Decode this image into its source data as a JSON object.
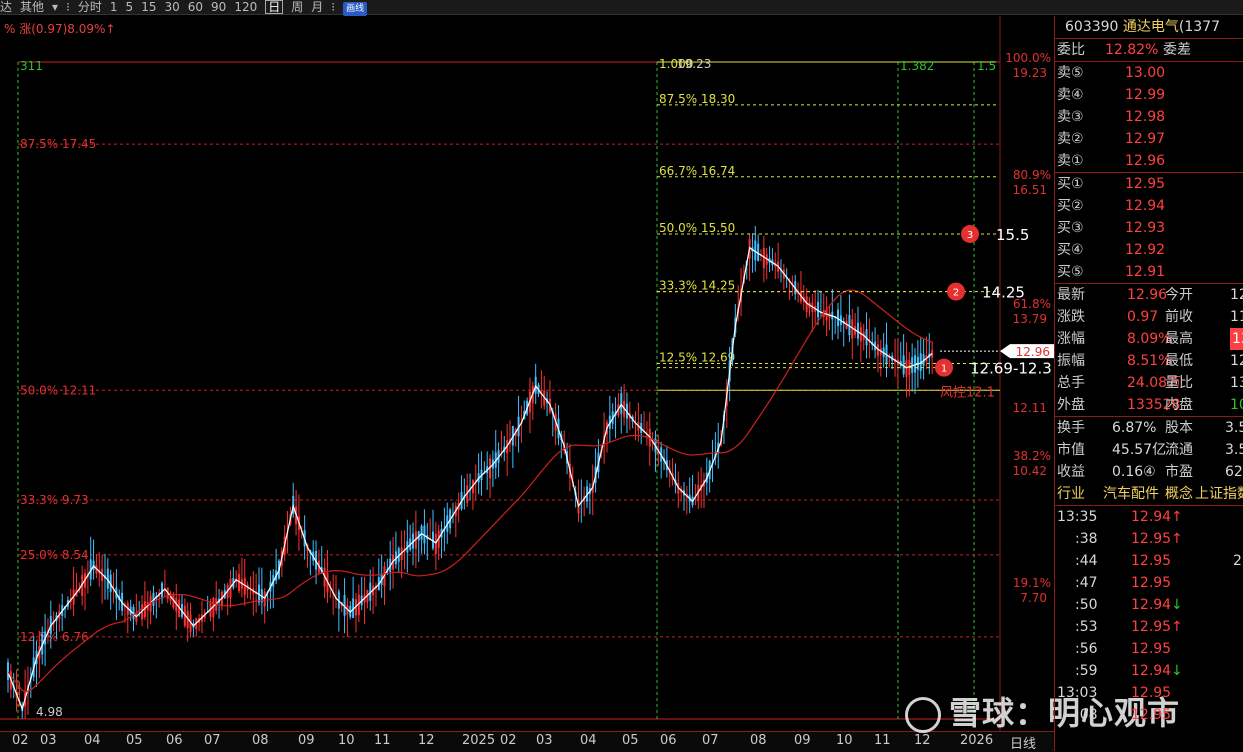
{
  "toolbar": {
    "items": [
      "达",
      "其他",
      "▾",
      "⁝",
      "分时",
      "1",
      "5",
      "15",
      "30",
      "60",
      "90",
      "120",
      "日",
      "周",
      "月",
      "⁝"
    ],
    "active": "日",
    "badge": "画线"
  },
  "indicator": "% 涨(0.97)8.09%↑",
  "stock": {
    "code": "603390",
    "name": "通达电气",
    "extra": "(1377"
  },
  "weibi": {
    "label1": "委比",
    "value": "12.82%",
    "label2": "委差"
  },
  "sell": [
    {
      "label": "卖⑤",
      "price": "13.00"
    },
    {
      "label": "卖④",
      "price": "12.99"
    },
    {
      "label": "卖③",
      "price": "12.98"
    },
    {
      "label": "卖②",
      "price": "12.97"
    },
    {
      "label": "卖①",
      "price": "12.96"
    }
  ],
  "buy": [
    {
      "label": "买①",
      "price": "12.95"
    },
    {
      "label": "买②",
      "price": "12.94"
    },
    {
      "label": "买③",
      "price": "12.93"
    },
    {
      "label": "买④",
      "price": "12.92"
    },
    {
      "label": "买⑤",
      "price": "12.91"
    }
  ],
  "quote": [
    {
      "l1": "最新",
      "v1": "12.96",
      "l2": "今开",
      "v2": "12"
    },
    {
      "l1": "涨跌",
      "v1": "0.97",
      "l2": "前收",
      "v2": "11"
    },
    {
      "l1": "涨幅",
      "v1": "8.09%",
      "l2": "最高",
      "v2": "13"
    },
    {
      "l1": "振幅",
      "v1": "8.51%",
      "l2": "最低",
      "v2": "12"
    },
    {
      "l1": "总手",
      "v1": "24.08万",
      "l2": "量比",
      "v2": "13"
    },
    {
      "l1": "外盘",
      "v1": "133528",
      "l2": "内盘",
      "v2": "107"
    }
  ],
  "stats": [
    {
      "l1": "换手",
      "v1": "6.87%",
      "l2": "股本",
      "v2": "3.5"
    },
    {
      "l1": "市值",
      "v1": "45.57亿",
      "l2": "流通",
      "v2": "3.5"
    },
    {
      "l1": "收益",
      "v1": "0.16④",
      "l2": "市盈",
      "v2": "62"
    }
  ],
  "industry": {
    "l1": "行业",
    "v1": "汽车配件",
    "l2": "概念",
    "v2": "上证指数"
  },
  "ticks": [
    {
      "t": "13:35",
      "p": "12.94",
      "a": "↑",
      "v": ""
    },
    {
      "t": ":38",
      "p": "12.95",
      "a": "↑",
      "v": ""
    },
    {
      "t": ":44",
      "p": "12.95",
      "a": "",
      "v": "2"
    },
    {
      "t": ":47",
      "p": "12.95",
      "a": "",
      "v": ""
    },
    {
      "t": ":50",
      "p": "12.94",
      "a": "↓",
      "v": ""
    },
    {
      "t": ":53",
      "p": "12.95",
      "a": "↑",
      "v": ""
    },
    {
      "t": ":56",
      "p": "12.95",
      "a": "",
      "v": ""
    },
    {
      "t": ":59",
      "p": "12.94",
      "a": "↓",
      "v": ""
    },
    {
      "t": "13:03",
      "p": "12.95",
      "a": "",
      "v": ""
    },
    {
      "t": ":08",
      "p": "12.95",
      "a": "",
      "v": ""
    }
  ],
  "watermark": "雪球：明心观市",
  "price_axis": [
    {
      "pct": "100.0%",
      "price": "19.23"
    },
    {
      "pct": "80.9%",
      "price": "16.51"
    },
    {
      "pct": "61.8%",
      "price": "13.79"
    },
    {
      "pct": "",
      "price": "12.11"
    },
    {
      "pct": "38.2%",
      "price": "10.42"
    },
    {
      "pct": "19.1%",
      "price": "7.70"
    },
    {
      "pct": "",
      "price": "4.98"
    }
  ],
  "current_price_tag": "12.96",
  "left_fib": [
    {
      "label": "87.5% 17.45",
      "price": 17.45
    },
    {
      "label": "50.0% 12.11",
      "price": 12.11
    },
    {
      "label": "33.3% 9.73",
      "price": 9.73
    },
    {
      "label": "25.0% 8.54",
      "price": 8.54
    },
    {
      "label": "12.5% 6.76",
      "price": 6.76
    }
  ],
  "right_fib": [
    {
      "label": "1.000",
      "price": 19.23
    },
    {
      "label": "87.5% 18.30",
      "price": 18.3
    },
    {
      "label": "66.7% 16.74",
      "price": 16.74
    },
    {
      "label": "50.0% 15.50",
      "price": 15.5
    },
    {
      "label": "33.3% 14.25",
      "price": 14.25
    },
    {
      "label": "12.5% 12.69",
      "price": 12.69
    }
  ],
  "targets": [
    {
      "num": "1",
      "label": "12.69-12.3",
      "price": 12.6
    },
    {
      "num": "2",
      "label": "14.25",
      "price": 14.25
    },
    {
      "num": "3",
      "label": "15.5",
      "price": 15.5
    }
  ],
  "risk_label": "风控12.1",
  "top_labels": {
    "left": "311",
    "high": "19.23",
    "r1": "1.382",
    "r2": "1.5"
  },
  "low_label": "4.98",
  "x_labels": [
    "02",
    "03",
    "04",
    "05",
    "06",
    "07",
    "08",
    "09",
    "10",
    "11",
    "12",
    "2025",
    "02",
    "03",
    "04",
    "05",
    "06",
    "07",
    "08",
    "09",
    "10",
    "11",
    "12",
    "2026"
  ],
  "x_suffix": "日线",
  "chart_data": {
    "type": "candlestick",
    "price_range": [
      4.98,
      19.23
    ],
    "series": [
      {
        "values": [
          6.0,
          5.2,
          6.3,
          7.0,
          7.4,
          7.8,
          8.3,
          8.0,
          7.5,
          7.2,
          7.5,
          7.8,
          7.4,
          7.0,
          7.3,
          7.6,
          8.0,
          7.8,
          7.6,
          8.2,
          9.6,
          8.7,
          8.2,
          7.6,
          7.3,
          7.6,
          7.9,
          8.4,
          8.7,
          9.0,
          8.8,
          9.3,
          9.8,
          10.2,
          10.5,
          10.9,
          11.4,
          12.2,
          11.8,
          10.9,
          9.6,
          10.0,
          11.3,
          11.8,
          11.4,
          11.1,
          10.6,
          10.0,
          9.7,
          10.2,
          11.0,
          13.5,
          15.2,
          15.0,
          14.8,
          14.4,
          14.0,
          13.8,
          13.7,
          13.5,
          13.3,
          13.0,
          12.8,
          12.6,
          12.7,
          12.96
        ]
      }
    ]
  }
}
